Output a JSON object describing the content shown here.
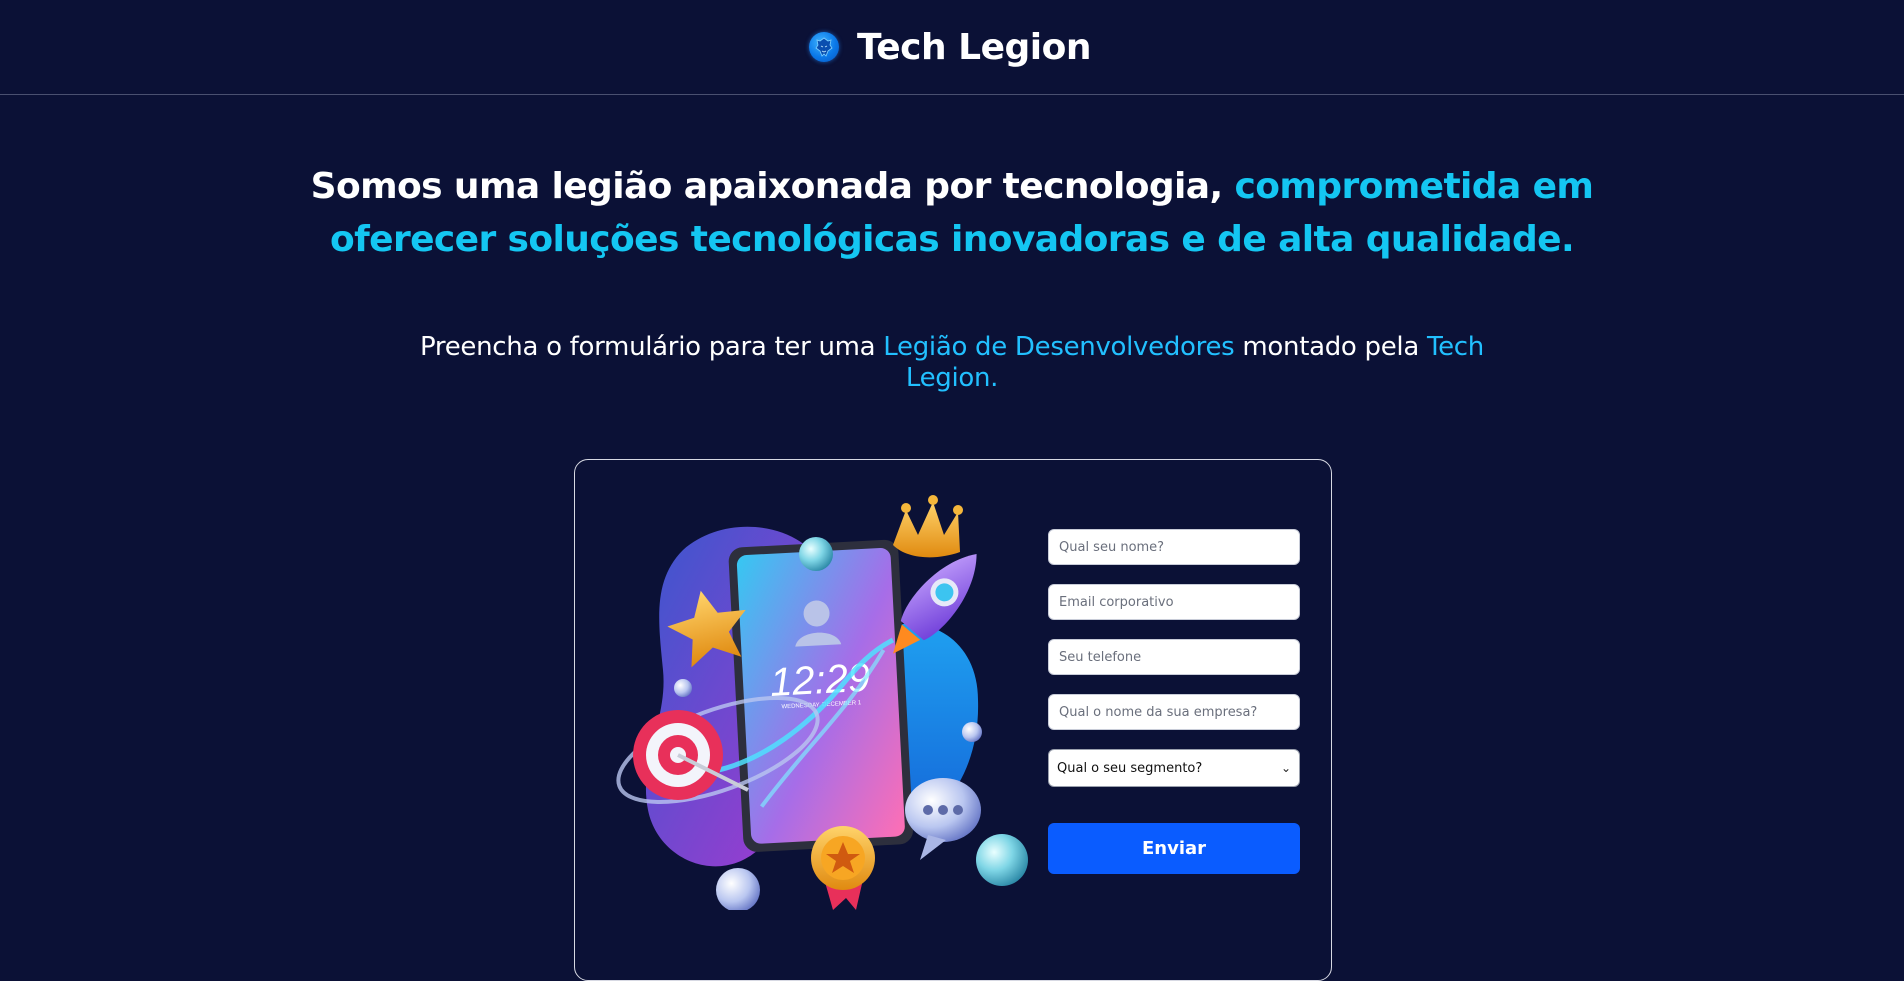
{
  "header": {
    "brand_name": "Tech Legion",
    "logo_icon": "lion-head-icon"
  },
  "headline": {
    "line1_white": "Somos uma legião apaixonada por tecnologia,",
    "line1_accent": "comprometida em",
    "line2_accent": "oferecer soluções tecnológicas inovadoras e de alta qualidade."
  },
  "subheadline": {
    "part1": "Preencha o formulário para ter uma",
    "part2_accent": "Legião de Desenvolvedores",
    "part3": "montado pela",
    "part4_accent": "Tech",
    "part5_accent": "Legion."
  },
  "illustration": {
    "clock_time": "12:29",
    "clock_date": "WEDNESDAY, DECEMBER 1"
  },
  "form": {
    "name_placeholder": "Qual seu nome?",
    "email_placeholder": "Email corporativo",
    "phone_placeholder": "Seu telefone",
    "company_placeholder": "Qual o nome da sua empresa?",
    "segment_selected": "Qual o seu segmento?",
    "submit_label": "Enviar"
  },
  "colors": {
    "background": "#0b1136",
    "accent": "#14c6f2",
    "button": "#0a5cff"
  }
}
